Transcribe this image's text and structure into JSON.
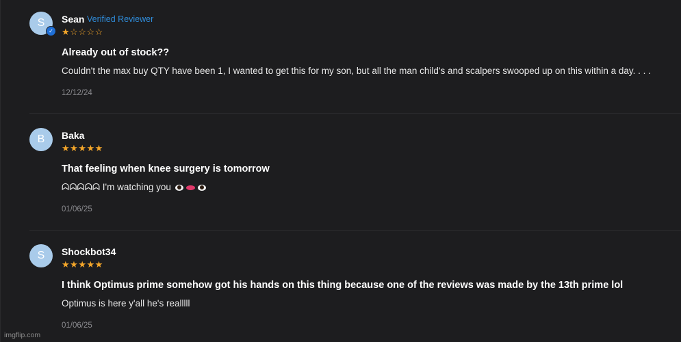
{
  "reviews": [
    {
      "avatar_letter": "S",
      "name": "Sean",
      "verified_label": "Verified Reviewer",
      "rating": 1,
      "max_rating": 5,
      "title": "Already out of stock??",
      "body": "Couldn't the max buy QTY have been 1, I wanted to get this for my son, but all the man child's and scalpers swooped up on this within a day. . . .",
      "date": "12/12/24"
    },
    {
      "avatar_letter": "B",
      "name": "Baka",
      "rating": 5,
      "max_rating": 5,
      "title": "That feeling when knee surgery is tomorrow",
      "body": "ᗣᗣᗣᗣᗣ I'm watching you",
      "date": "01/06/25"
    },
    {
      "avatar_letter": "S",
      "name": "Shockbot34",
      "rating": 5,
      "max_rating": 5,
      "title": "I think Optimus prime somehow got his hands on this thing because one of the reviews was made by the 13th prime lol",
      "body": "Optimus is here y'all he's realllll",
      "date": "01/06/25"
    }
  ],
  "watermark": "imgflip.com",
  "colors": {
    "background": "#1d1d1f",
    "star": "#f4a62a",
    "verified": "#2f8bd8",
    "avatar": "#a9cbea",
    "date": "#8a8a8e"
  }
}
